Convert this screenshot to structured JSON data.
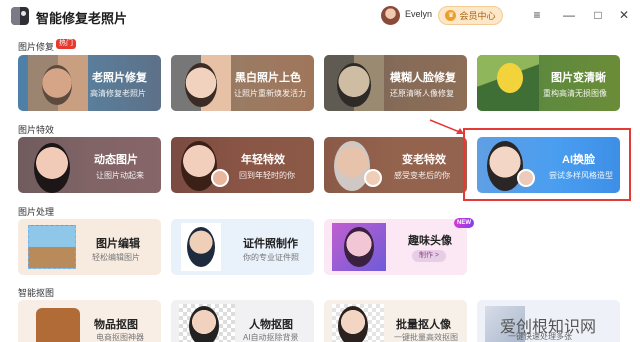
{
  "app": {
    "title": "智能修复老照片",
    "username": "Evelyn",
    "vip_label": "会员中心"
  },
  "window_controls": {
    "menu": "≡",
    "minimize": "—",
    "maximize": "□",
    "close": "✕"
  },
  "sections": {
    "repair": {
      "title": "图片修复",
      "badge": "热门"
    },
    "effects": {
      "title": "图片特效"
    },
    "processing": {
      "title": "图片处理"
    },
    "cutout": {
      "title": "智能抠图"
    }
  },
  "repair_cards": [
    {
      "label": "老照片修复",
      "sub": "高清修复老照片"
    },
    {
      "label": "黑白照片上色",
      "sub": "让照片重新焕发活力"
    },
    {
      "label": "模糊人脸修复",
      "sub": "还原清晰人像修复"
    },
    {
      "label": "图片变清晰",
      "sub": "重构高清无损图像"
    }
  ],
  "effect_cards": [
    {
      "label": "动态图片",
      "sub": "让图片动起来"
    },
    {
      "label": "年轻特效",
      "sub": "回到年轻时的你"
    },
    {
      "label": "变老特效",
      "sub": "感受变老后的你"
    },
    {
      "label": "AI换脸",
      "sub": "尝试多样风格造型"
    }
  ],
  "processing_cards": [
    {
      "label": "图片编辑",
      "sub": "轻松编辑图片"
    },
    {
      "label": "证件照制作",
      "sub": "你的专业证件照"
    },
    {
      "label": "趣味头像",
      "sub": "制作 >",
      "badge": "NEW"
    }
  ],
  "cutout_cards": [
    {
      "label": "物品抠图",
      "sub": "电商抠图神器"
    },
    {
      "label": "人物抠图",
      "sub": "AI自动抠除背景"
    },
    {
      "label": "批量抠人像",
      "sub": "一键批量高效抠图"
    },
    {
      "label": "",
      "sub": "一键快速处理多张"
    }
  ],
  "watermark": {
    "text": "爱创根知识网",
    "sub": "一键快速处理多张"
  },
  "colors": {
    "accent_red": "#e33a36",
    "vip_gold": "#e9a02d",
    "ai_blue": "#4a9ef0"
  }
}
